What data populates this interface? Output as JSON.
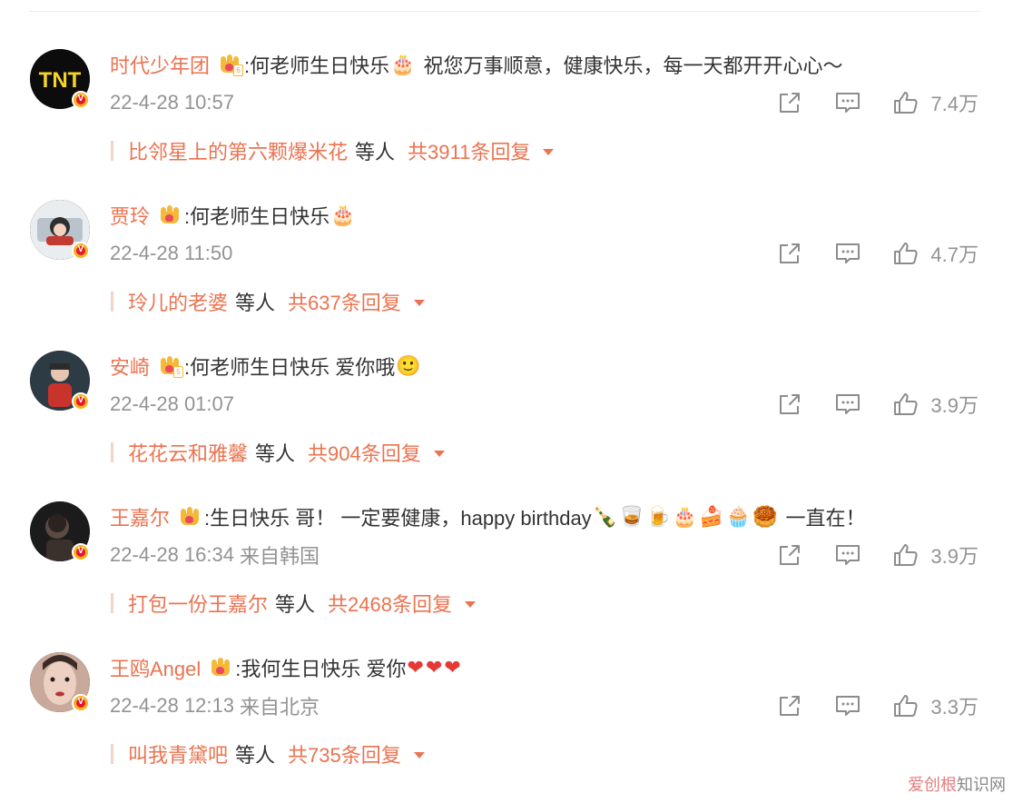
{
  "comments": [
    {
      "username": "时代少年团",
      "text": ":何老师生日快乐",
      "emoji_after": [
        "🎂"
      ],
      "text2": "祝您万事顺意，健康快乐，每一天都开开心心～",
      "emoji_end": [],
      "timestamp": "22-4-28 10:57",
      "location": "",
      "likes": "7.4万",
      "reply_user": "比邻星上的第六颗爆米花",
      "reply_mid": "等人",
      "reply_total": "共3911条回复",
      "avatar_style": "tnt",
      "crown_level": "6"
    },
    {
      "username": "贾玲",
      "text": ":何老师生日快乐",
      "emoji_after": [
        "🎂"
      ],
      "text2": "",
      "emoji_end": [],
      "timestamp": "22-4-28 11:50",
      "location": "",
      "likes": "4.7万",
      "reply_user": "玲儿的老婆",
      "reply_mid": "等人",
      "reply_total": "共637条回复",
      "avatar_style": "light",
      "crown_level": ""
    },
    {
      "username": "安崎",
      "text": ":何老师生日快乐 爱你哦",
      "emoji_after": [
        "🙂"
      ],
      "text2": "",
      "emoji_end": [],
      "timestamp": "22-4-28 01:07",
      "location": "",
      "likes": "3.9万",
      "reply_user": "花花云和雅馨",
      "reply_mid": "等人",
      "reply_total": "共904条回复",
      "avatar_style": "red",
      "crown_level": "5"
    },
    {
      "username": "王嘉尔",
      "text": ":生日快乐 哥！ 一定要健康，happy birthday",
      "emoji_after": [
        "🍾",
        "🥃",
        "🍺",
        "🎂",
        "🍰",
        "🧁",
        "🥮"
      ],
      "text2": "一直在！",
      "emoji_end": [],
      "timestamp": "22-4-28 16:34",
      "location": "来自韩国",
      "likes": "3.9万",
      "reply_user": "打包一份王嘉尔",
      "reply_mid": "等人",
      "reply_total": "共2468条回复",
      "avatar_style": "dark",
      "crown_level": ""
    },
    {
      "username": "王鸥Angel",
      "text": ":我何生日快乐 爱你",
      "emoji_after": [
        "❤",
        "❤",
        "❤"
      ],
      "text2": "",
      "emoji_end": [],
      "timestamp": "22-4-28 12:13",
      "location": "来自北京",
      "likes": "3.3万",
      "reply_user": "叫我青黛吧",
      "reply_mid": "等人",
      "reply_total": "共735条回复",
      "avatar_style": "face",
      "crown_level": ""
    }
  ],
  "icons": {
    "share": "share-icon",
    "comment": "comment-icon",
    "like": "thumbs-up-icon",
    "verified": "verified-v-icon",
    "crown": "vip-crown-icon"
  },
  "colors": {
    "username": "#eb7350",
    "meta": "#939393",
    "text": "#333333",
    "badge": "#f6b220"
  },
  "watermark": {
    "part1": "爱创根",
    "part2": "知识网"
  }
}
